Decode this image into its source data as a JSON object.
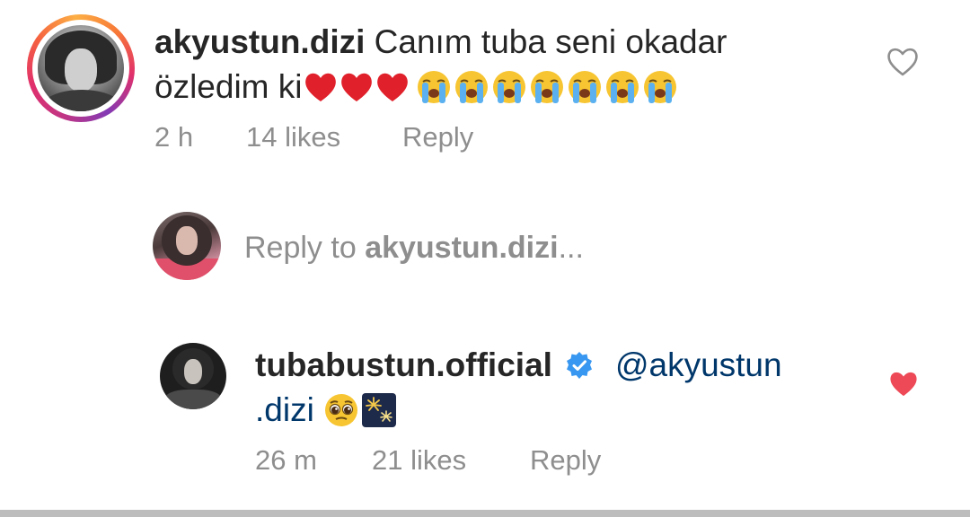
{
  "comments": [
    {
      "username": "akyustun.dizi",
      "text_line1": "Canım tuba seni okadar",
      "text_line2": "özledim ki",
      "time": "2 h",
      "likes": "14 likes",
      "reply_label": "Reply",
      "liked": false,
      "has_story_ring": true,
      "emojis": [
        "red-heart",
        "red-heart",
        "red-heart",
        "loudly-crying-face",
        "loudly-crying-face",
        "loudly-crying-face",
        "loudly-crying-face",
        "loudly-crying-face",
        "loudly-crying-face",
        "loudly-crying-face"
      ]
    },
    {
      "username": "tubabustun.official",
      "verified": true,
      "mention_part1": "@akyustun",
      "mention_part2": ".dizi",
      "time": "26 m",
      "likes": "21 likes",
      "reply_label": "Reply",
      "liked": true,
      "emojis": [
        "pleading-face",
        "fireworks"
      ]
    }
  ],
  "reply_composer": {
    "prefix": "Reply to ",
    "username": "akyustun.dizi",
    "suffix": "..."
  },
  "colors": {
    "text": "#262626",
    "secondary": "#8e8e8e",
    "mention": "#00376b",
    "like_red": "#ed4956",
    "verified_blue": "#3897f0"
  },
  "icons": {
    "like_outline": "heart-outline-icon",
    "like_filled": "heart-filled-icon",
    "verified": "verified-badge-icon"
  }
}
